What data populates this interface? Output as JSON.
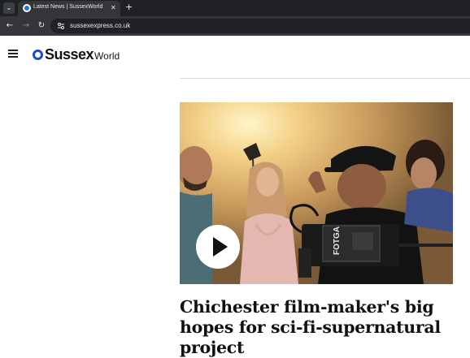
{
  "browser": {
    "tab_title": "Latest News | SussexWorld",
    "url": "sussexexpress.co.uk",
    "tab_close_glyph": "✕",
    "new_tab_glyph": "+",
    "menu_glyph": "⌄",
    "back_glyph": "←",
    "forward_glyph": "→",
    "reload_glyph": "↻"
  },
  "site": {
    "logo_main": "Sussex",
    "logo_sub": "World",
    "brand_color": "#1e4bd2"
  },
  "article": {
    "headline": "Chichester film-maker's big hopes for sci-fi-supernatural project",
    "camera_brand": "FOTGA"
  }
}
